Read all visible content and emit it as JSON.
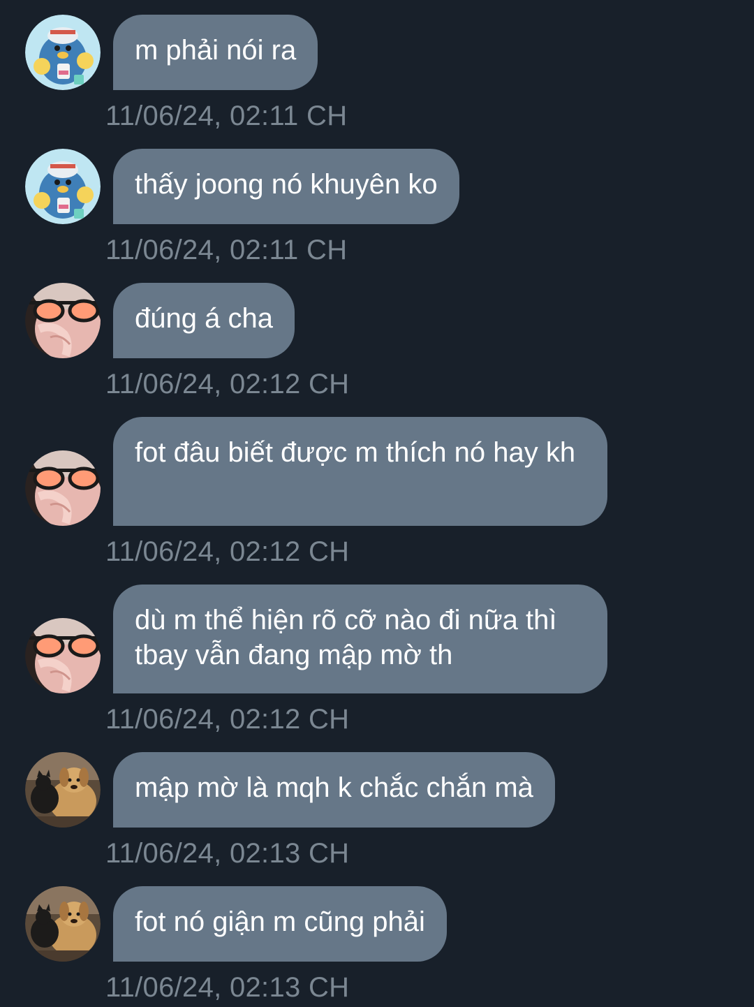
{
  "messages": [
    {
      "avatar": "penguin-cartoon",
      "text": "m phải nói ra",
      "time": "11/06/24, 02:11 CH"
    },
    {
      "avatar": "penguin-cartoon",
      "text": "thấy joong nó khuyên ko",
      "time": "11/06/24, 02:11 CH"
    },
    {
      "avatar": "person-orange-sunglasses",
      "text": "đúng á cha",
      "time": "11/06/24, 02:12 CH"
    },
    {
      "avatar": "person-orange-sunglasses",
      "text": "fot đâu biết được m thích nó hay kh",
      "time": "11/06/24, 02:12 CH"
    },
    {
      "avatar": "person-orange-sunglasses",
      "text": "dù m thể hiện rõ cỡ nào đi nữa thì tbay vẫn đang mập mờ th",
      "time": "11/06/24, 02:12 CH"
    },
    {
      "avatar": "dog-and-cat-photo",
      "text": "mập mờ là mqh k chắc chắn mà",
      "time": "11/06/24, 02:13 CH"
    },
    {
      "avatar": "dog-and-cat-photo",
      "text": "fot nó giận m cũng phải",
      "time": "11/06/24, 02:13 CH"
    }
  ],
  "colors": {
    "background": "#18202a",
    "bubble": "#667788",
    "bubble_text": "#ffffff",
    "timestamp": "#7b8792"
  }
}
